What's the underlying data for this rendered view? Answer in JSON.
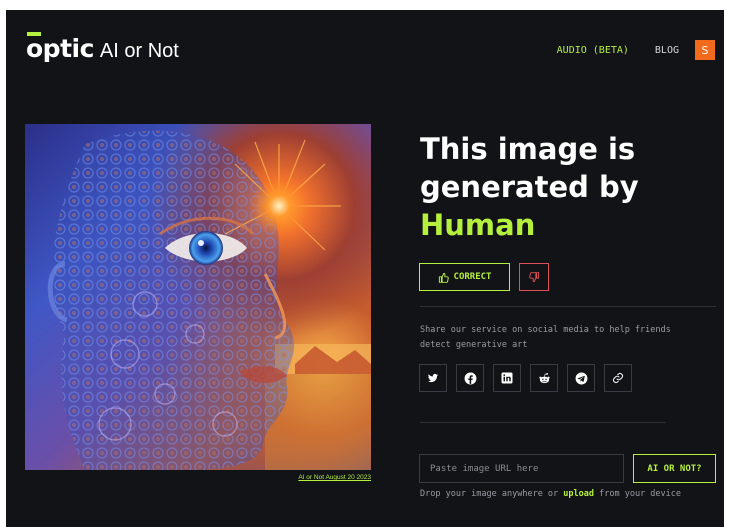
{
  "header": {
    "logo_mark": "optic",
    "logo_text": "AI or Not",
    "nav": {
      "audio": "AUDIO (BETA)",
      "blog": "BLOG"
    },
    "avatar_initial": "S"
  },
  "image": {
    "caption": "AI or Not August 20 2023"
  },
  "result": {
    "line1": "This image is",
    "line2": "generated by",
    "verdict": "Human"
  },
  "feedback": {
    "correct_label": "CORRECT",
    "correct_icon": "thumbs-up-icon",
    "wrong_icon": "thumbs-down-icon"
  },
  "share": {
    "text": "Share our service on social media to help friends detect generative art",
    "icons": [
      "twitter-icon",
      "facebook-icon",
      "linkedin-icon",
      "reddit-icon",
      "telegram-icon",
      "link-icon"
    ]
  },
  "upload": {
    "url_placeholder": "Paste image URL here",
    "submit_label": "AI OR NOT?",
    "drop_before": "Drop your image anywhere or ",
    "drop_link": "upload",
    "drop_after": " from your device"
  },
  "colors": {
    "accent": "#b6f03e",
    "background": "#121317",
    "avatar": "#f26b1d",
    "negative": "#e0505a"
  }
}
